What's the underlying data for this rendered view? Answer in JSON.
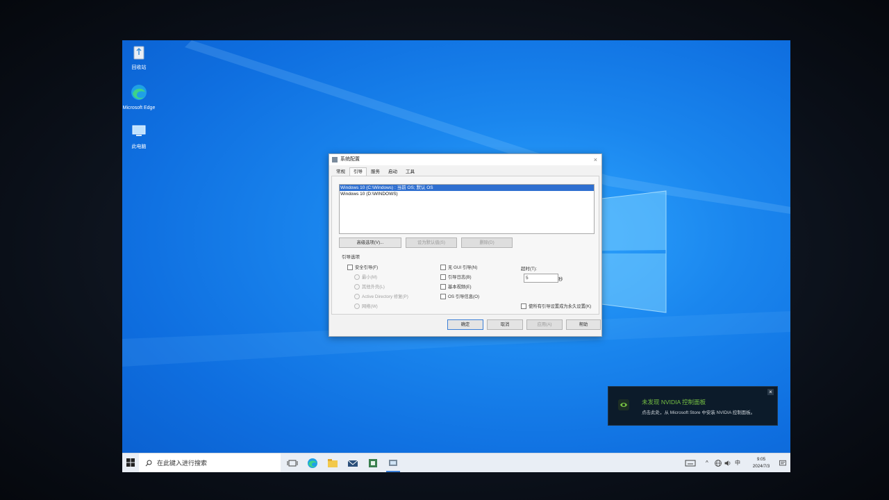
{
  "desktop": {
    "icons": [
      {
        "label": "回收站",
        "icon": "recycle-bin-icon"
      },
      {
        "label": "Microsoft Edge",
        "icon": "edge-icon"
      },
      {
        "label": "此电脑",
        "icon": "this-pc-icon"
      }
    ]
  },
  "dialog": {
    "title": "系统配置",
    "close_glyph": "×",
    "tabs": [
      "常规",
      "引导",
      "服务",
      "启动",
      "工具"
    ],
    "active_tab": "引导",
    "os_list": [
      "Windows 10 (C:\\Windows) : 当前 OS; 默认 OS",
      "Windows 10 (D:\\WINDOWS)"
    ],
    "buttons": {
      "advanced": "高级选项(V)...",
      "set_default": "设为默认值(S)",
      "delete": "删除(D)"
    },
    "boot_options_label": "引导选项",
    "options": {
      "safe_boot": "安全引导(F)",
      "minimal": "最小(M)",
      "alternate_shell": "其他外壳(L)",
      "ad_repair": "Active Directory 修复(P)",
      "network": "网络(W)",
      "no_gui": "无 GUI 引导(N)",
      "boot_log": "引导日志(B)",
      "base_video": "基本视频(E)",
      "os_boot_info": "OS 引导信息(O)"
    },
    "timeout_label": "超时(T):",
    "timeout_value": "5",
    "timeout_unit": "秒",
    "permanent_label": "使所有引导设置成为永久设置(K)",
    "footer": {
      "ok": "确定",
      "cancel": "取消",
      "apply": "应用(A)",
      "help": "帮助"
    }
  },
  "notification": {
    "title": "未发现 NVIDIA 控制面板",
    "body": "点击此处，从 Microsoft Store 中安装 NVIDIA 控制面板。",
    "close_glyph": "×"
  },
  "taskbar": {
    "search_placeholder": "在此键入进行搜索",
    "ime": "中",
    "time": "9:05",
    "date": "2024/7/3"
  },
  "colors": {
    "desktop_blue": "#1a86ee",
    "selection": "#2f6fd0",
    "nvidia_green": "#76c043"
  }
}
